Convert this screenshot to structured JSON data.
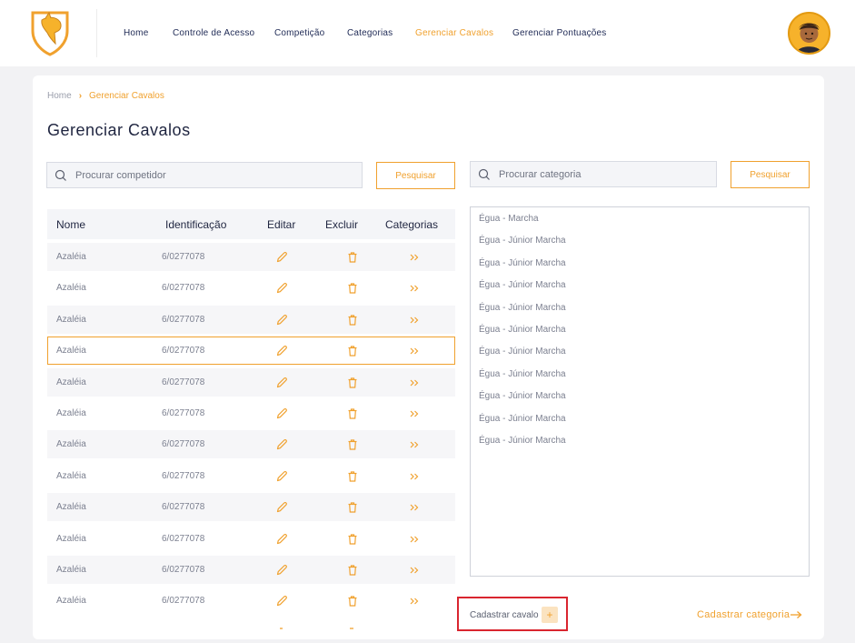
{
  "nav": {
    "items": [
      "Home",
      "Controle de Acesso",
      "Competição",
      "Categorias",
      "Gerenciar Cavalos",
      "Gerenciar Pontuações"
    ],
    "active_index": 4
  },
  "breadcrumb": {
    "home": "Home",
    "current": "Gerenciar Cavalos"
  },
  "page_title": "Gerenciar Cavalos",
  "competitor_search": {
    "placeholder": "Procurar competidor",
    "button": "Pesquisar"
  },
  "category_search": {
    "placeholder": "Procurar categoria",
    "button": "Pesquisar"
  },
  "table": {
    "headers": [
      "Nome",
      "Identificação",
      "Editar",
      "Excluir",
      "Categorias"
    ],
    "rows": [
      {
        "nome": "Azaléia",
        "id": "6/0277078"
      },
      {
        "nome": "Azaléia",
        "id": "6/0277078"
      },
      {
        "nome": "Azaléia",
        "id": "6/0277078"
      },
      {
        "nome": "Azaléia",
        "id": "6/0277078"
      },
      {
        "nome": "Azaléia",
        "id": "6/0277078"
      },
      {
        "nome": "Azaléia",
        "id": "6/0277078"
      },
      {
        "nome": "Azaléia",
        "id": "6/0277078"
      },
      {
        "nome": "Azaléia",
        "id": "6/0277078"
      },
      {
        "nome": "Azaléia",
        "id": "6/0277078"
      },
      {
        "nome": "Azaléia",
        "id": "6/0277078"
      },
      {
        "nome": "Azaléia",
        "id": "6/0277078"
      },
      {
        "nome": "Azaléia",
        "id": "6/0277078"
      }
    ],
    "selected_index": 3
  },
  "categories": [
    "Égua - Marcha",
    "Égua - Júnior Marcha",
    "Égua - Júnior Marcha",
    "Égua - Júnior Marcha",
    "Égua - Júnior Marcha",
    "Égua - Júnior Marcha",
    "Égua - Júnior Marcha",
    "Égua - Júnior Marcha",
    "Égua - Júnior Marcha",
    "Égua - Júnior Marcha",
    "Égua - Júnior Marcha"
  ],
  "footer": {
    "add_horse": "Cadastrar cavalo",
    "add_horse_icon": "+",
    "add_category": "Cadastrar categoria"
  },
  "colors": {
    "accent": "#f0a12e",
    "navy": "#1f2540",
    "highlight": "#d9252f"
  }
}
